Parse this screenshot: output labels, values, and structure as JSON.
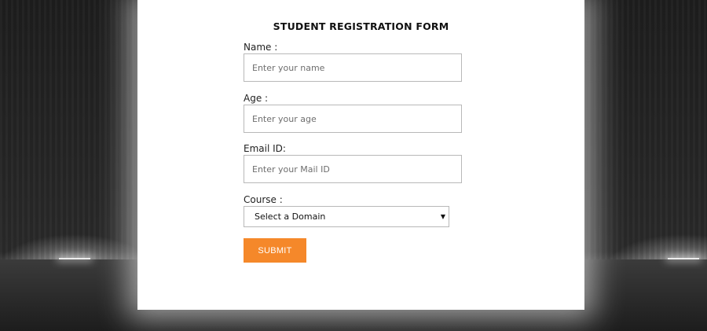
{
  "form": {
    "title": "STUDENT REGISTRATION FORM",
    "name": {
      "label": "Name :",
      "placeholder": "Enter your name",
      "value": ""
    },
    "age": {
      "label": "Age :",
      "placeholder": "Enter your age",
      "value": ""
    },
    "email": {
      "label": "Email ID:",
      "placeholder": "Enter your Mail ID",
      "value": ""
    },
    "course": {
      "label": "Course :",
      "selected": "Select a Domain",
      "arrow_icon": "▼"
    },
    "submit_label": "SUBMIT"
  },
  "colors": {
    "accent": "#f5882a",
    "card_background": "#ffffff",
    "page_background": "#2a2a2a"
  }
}
